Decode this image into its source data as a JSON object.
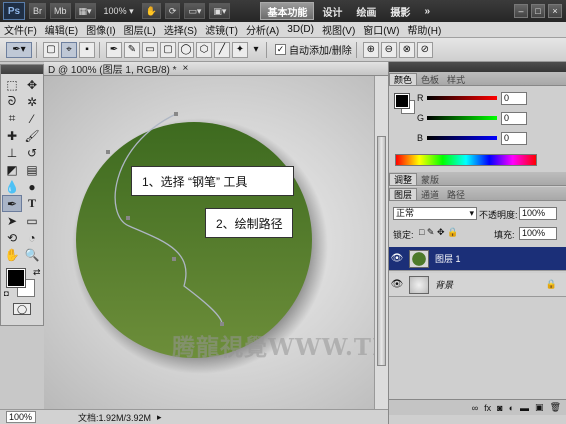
{
  "app": {
    "logo": "Ps",
    "bridge_btn": "Br",
    "mini_bridge_btn": "Mb",
    "zoom_select": "100%",
    "workspaces": [
      "基本功能",
      "设计",
      "绘画",
      "摄影"
    ],
    "more": "»",
    "window_controls": [
      "–",
      "□",
      "×"
    ]
  },
  "menu": [
    "文件(F)",
    "编辑(E)",
    "图像(I)",
    "图层(L)",
    "选择(S)",
    "滤镜(T)",
    "分析(A)",
    "3D(D)",
    "视图(V)",
    "窗口(W)",
    "帮助(H)"
  ],
  "options": {
    "auto_add_delete_label": "自动添加/删除",
    "auto_add_delete_checked": true
  },
  "document": {
    "tab_title": "D @ 100% (图层 1, RGB/8) *",
    "callout1": "1、选择 “钢笔” 工具",
    "callout2": "2、绘制路径",
    "watermark": "腾龍視覺WWW.TLVI.NET",
    "circle_color_top": "#3d6a1f",
    "circle_color_bottom": "#6d8e3a"
  },
  "status": {
    "zoom": "100%",
    "doc_info": "文档:1.92M/3.92M"
  },
  "color_panel": {
    "tabs": [
      "颜色",
      "色板",
      "样式"
    ],
    "sliders": [
      {
        "label": "R",
        "value": "0"
      },
      {
        "label": "G",
        "value": "0"
      },
      {
        "label": "B",
        "value": "0"
      }
    ]
  },
  "adjust_panel": {
    "tabs": [
      "调整",
      "蒙版"
    ]
  },
  "layers_panel": {
    "tabs": [
      "图层",
      "通道",
      "路径"
    ],
    "blend_mode": "正常",
    "opacity_label": "不透明度:",
    "opacity_value": "100%",
    "lock_label": "锁定:",
    "fill_label": "填充:",
    "fill_value": "100%",
    "layers": [
      {
        "name": "图层 1",
        "selected": true
      },
      {
        "name": "背景",
        "selected": false
      }
    ]
  }
}
